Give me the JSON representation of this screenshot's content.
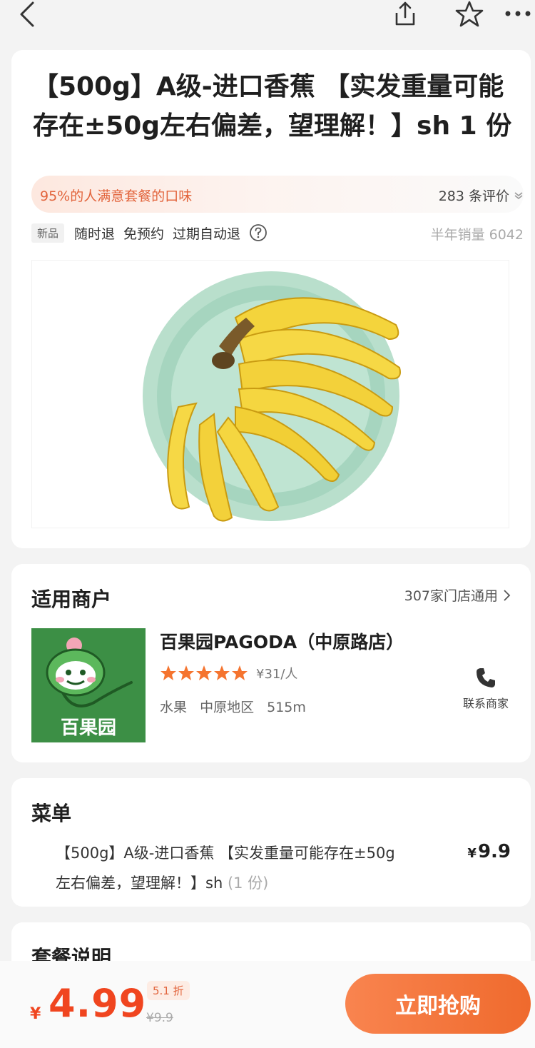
{
  "deal": {
    "title": "【500g】A级-进口香蕉 【实发重量可能存在±50g左右偏差，望理解！】sh 1 份",
    "satisfaction": "95%的人满意套餐的口味",
    "reviews": "283 条评价",
    "new_badge": "新品",
    "tags": [
      "随时退",
      "免预约",
      "过期自动退"
    ],
    "sales": "半年销量 6042"
  },
  "merchant_section": {
    "title": "适用商户",
    "stores_link": "307家门店通用",
    "name": "百果园PAGODA（中原路店）",
    "rating_stars": 5,
    "avg_price": "¥31/人",
    "category": "水果",
    "area": "中原地区",
    "distance": "515m",
    "contact_label": "联系商家",
    "logo_text": "百果园"
  },
  "menu_section": {
    "title": "菜单",
    "item_name": "【500g】A级-进口香蕉 【实发重量可能存在±50g左右偏差，望理解！】sh",
    "item_qty": "(1 份)",
    "item_price_symbol": "¥",
    "item_price": "9.9"
  },
  "desc_section": {
    "title": "套餐说明"
  },
  "bottom_bar": {
    "currency": "¥",
    "price": "4.99",
    "discount": "5.1 折",
    "original_price": "¥9.9",
    "buy_label": "立即抢购"
  },
  "colors": {
    "accent": "#f0451f",
    "button": "#ef6a2d",
    "star": "#f5742f",
    "logo_green": "#3c8f45"
  }
}
